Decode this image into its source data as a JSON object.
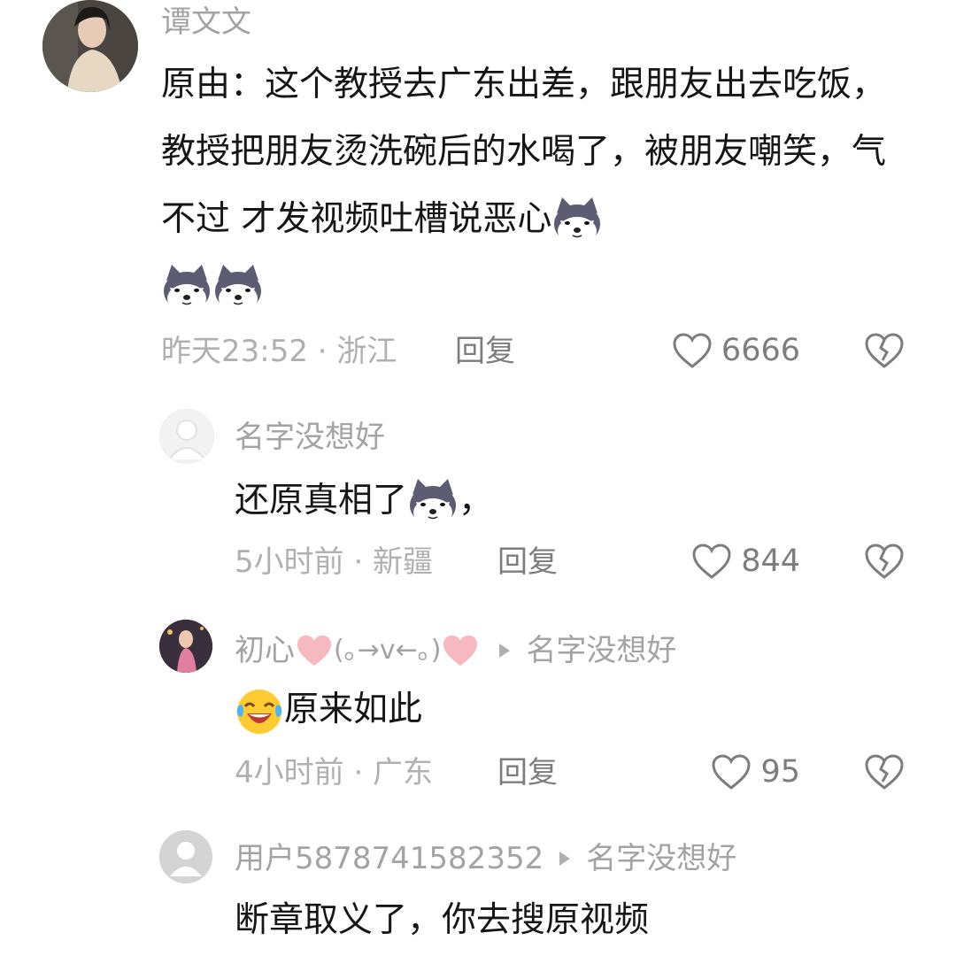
{
  "comments": [
    {
      "author": "谭文文",
      "text_part1": "原由：这个教授去广东出差，跟朋友出去吃饭，教授把朋友烫洗碗后的水喝了，被朋友嘲笑，气不过 才发视频吐槽说恶心",
      "time_location": "昨天23:52 · 浙江",
      "reply_label": "回复",
      "like_count": "6666",
      "emoji_icon": "husky-emoji-icon"
    }
  ],
  "replies": [
    {
      "author": "名字没想好",
      "text": "还原真相了",
      "text_suffix": "，",
      "time_location": "5小时前 · 新疆",
      "reply_label": "回复",
      "like_count": "844"
    },
    {
      "author_prefix": "初心",
      "author_kaomoji": "(｡→v←｡)",
      "reply_to": "名字没想好",
      "text": "原来如此",
      "emoji_icon": "laughing-crying-emoji-icon",
      "time_location": "4小时前 · 广东",
      "reply_label": "回复",
      "like_count": "95"
    },
    {
      "author": "用户5878741582352",
      "reply_to": "名字没想好",
      "text": "断章取义了，你去搜原视频"
    }
  ],
  "colors": {
    "meta_gray": "#b0b0b0",
    "name_gray": "#a3a3a3",
    "heart_pink": "#f6b9bf",
    "text_black": "#161616"
  }
}
